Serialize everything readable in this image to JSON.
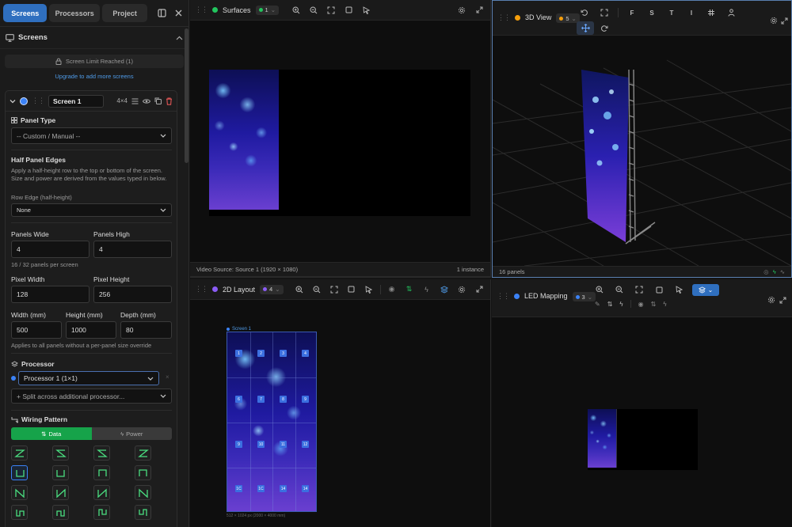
{
  "sidebar": {
    "tabs": [
      {
        "label": "Screens"
      },
      {
        "label": "Processors"
      },
      {
        "label": "Project"
      }
    ],
    "section_title": "Screens",
    "limit_text": "Screen Limit Reached (1)",
    "upgrade_link": "Upgrade to add more screens",
    "screen": {
      "name": "Screen 1",
      "size": "4×4",
      "color": "#3b82f6",
      "panel_type_label": "Panel Type",
      "panel_type_value": "-- Custom / Manual --",
      "half_edges_title": "Half Panel Edges",
      "half_edges_desc": "Apply a half-height row to the top or bottom of the screen. Size and power are derived from the values typed in below.",
      "row_edge_label": "Row Edge (half-height)",
      "row_edge_value": "None",
      "panels_wide_label": "Panels Wide",
      "panels_wide": "4",
      "panels_high_label": "Panels High",
      "panels_high": "4",
      "panels_count_note": "16 / 32 panels per screen",
      "pixel_width_label": "Pixel Width",
      "pixel_width": "128",
      "pixel_height_label": "Pixel Height",
      "pixel_height": "256",
      "width_label": "Width (mm)",
      "width": "500",
      "height_label": "Height (mm)",
      "height": "1000",
      "depth_label": "Depth (mm)",
      "depth": "80",
      "applies_note": "Applies to all panels without a per-panel size override",
      "processor_label": "Processor",
      "processor_value": "Processor 1 (1×1)",
      "split_label": "+ Split across additional processor...",
      "wiring_label": "Wiring Pattern",
      "wiring_tabs": [
        {
          "label": "Data"
        },
        {
          "label": "Power"
        }
      ]
    }
  },
  "panels": {
    "surfaces": {
      "title": "Surfaces",
      "count": "1",
      "footer_left": "Video Source: Source 1 (1920 × 1080)",
      "footer_right": "1 instance",
      "dot_color": "#22c55e"
    },
    "view3d": {
      "title": "3D View",
      "count": "5",
      "footer_left": "16 panels",
      "dot_color": "#f59e0b",
      "view_letters": [
        "F",
        "S",
        "T",
        "I"
      ]
    },
    "layout2d": {
      "title": "2D Layout",
      "count": "4",
      "dot_color": "#8b5cf6",
      "screen_label": "Screen 1",
      "footer_note": "512 × 1024 px (2000 × 4000 mm)",
      "cells": [
        "1",
        "2",
        "3",
        "4",
        "6",
        "7",
        "8",
        "9",
        "9",
        "10",
        "11",
        "12",
        "1C",
        "1C",
        "14",
        "14"
      ]
    },
    "ledmap": {
      "title": "LED Mapping",
      "count": "3",
      "dot_color": "#3b82f6"
    }
  },
  "colors": {
    "accent": "#2f6fbf",
    "data_green": "#22c55e",
    "blue_cell": "#3b6fe0"
  }
}
